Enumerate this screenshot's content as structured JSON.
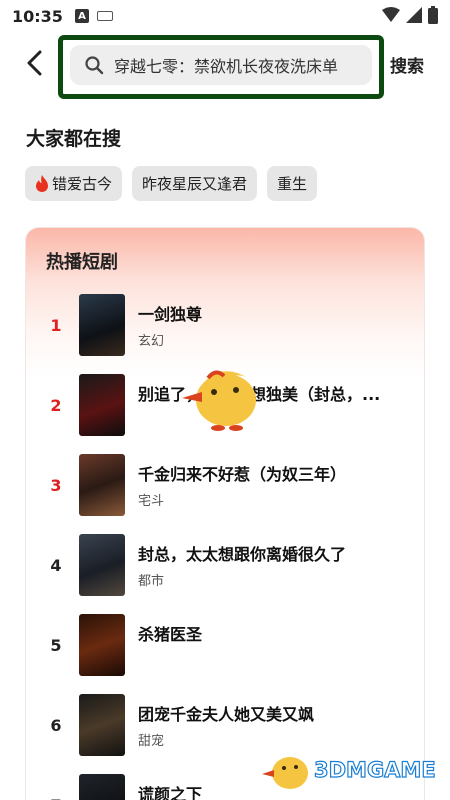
{
  "status_bar": {
    "time": "10:35",
    "app_icon_letter": "A"
  },
  "search": {
    "query": "穿越七零：禁欲机长夜夜洗床单",
    "action_label": "搜索"
  },
  "trending": {
    "title": "大家都在搜",
    "chips": [
      "错爱古今",
      "昨夜星辰又逢君",
      "重生"
    ]
  },
  "hot": {
    "title": "热播短剧",
    "items": [
      {
        "rank": "1",
        "title": "一剑独尊",
        "tag": "玄幻"
      },
      {
        "rank": "2",
        "title": "别追了，太太只想独美（封总，...",
        "tag": ""
      },
      {
        "rank": "3",
        "title": "千金归来不好惹（为奴三年）",
        "tag": "宅斗"
      },
      {
        "rank": "4",
        "title": "封总，太太想跟你离婚很久了",
        "tag": "都市"
      },
      {
        "rank": "5",
        "title": "杀猪医圣",
        "tag": ""
      },
      {
        "rank": "6",
        "title": "团宠千金夫人她又美又飒",
        "tag": "甜宠"
      },
      {
        "rank": "7",
        "title": "谎颜之下",
        "tag": ""
      }
    ]
  },
  "watermark": {
    "text": "3DMGAME"
  },
  "colors": {
    "rank_top": "#e02020",
    "highlight_frame": "#0c4a12",
    "card_gradient": "#fbb7a8"
  }
}
